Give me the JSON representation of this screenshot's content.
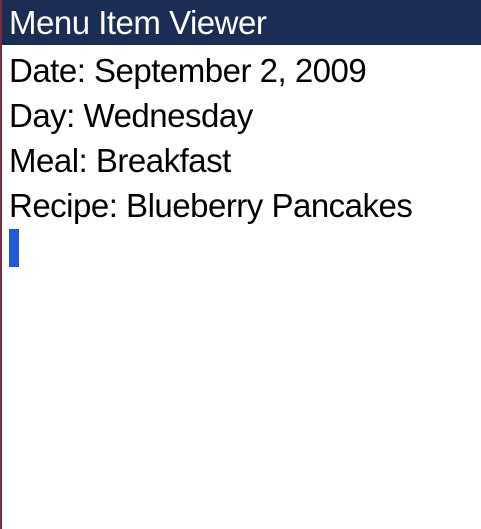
{
  "app": {
    "title": "Menu Item Viewer"
  },
  "details": {
    "date": "Date: September 2, 2009",
    "day": "Day: Wednesday",
    "meal": "Meal: Breakfast",
    "recipe": "Recipe: Blueberry Pancakes"
  },
  "colors": {
    "title_bar_bg": "#1c2d55",
    "title_bar_text": "#ffffff",
    "cursor": "#1f5bd6",
    "left_border": "#7a2b40"
  }
}
